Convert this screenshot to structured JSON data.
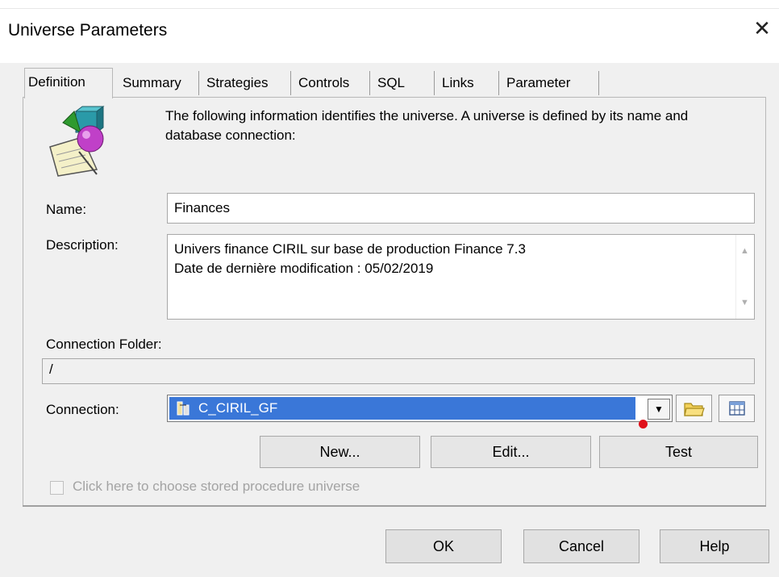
{
  "window": {
    "title": "Universe Parameters",
    "close_glyph": "✕"
  },
  "tabs": [
    {
      "label": "Definition",
      "active": true
    },
    {
      "label": "Summary",
      "active": false
    },
    {
      "label": "Strategies",
      "active": false
    },
    {
      "label": "Controls",
      "active": false
    },
    {
      "label": "SQL",
      "active": false
    },
    {
      "label": "Links",
      "active": false
    },
    {
      "label": "Parameter",
      "active": false
    }
  ],
  "definition": {
    "intro": "The following information identifies the universe. A universe is defined by its name and database connection:",
    "name_label": "Name:",
    "name_value": "Finances",
    "description_label": "Description:",
    "description_lines": [
      "Univers finance CIRIL sur base de production Finance 7.3",
      "Date de dernière modification : 05/02/2019"
    ],
    "connection_folder_label": "Connection Folder:",
    "connection_folder_value": "/",
    "connection_label": "Connection:",
    "connection_value": "C_CIRIL_GF",
    "buttons": {
      "new": "New...",
      "edit": "Edit...",
      "test": "Test"
    },
    "stored_procedure_label": "Click here to choose stored procedure universe",
    "stored_procedure_checked": false
  },
  "footer": {
    "ok": "OK",
    "cancel": "Cancel",
    "help": "Help"
  },
  "icons": {
    "universe": "universe-shapes-icon",
    "connection": "connection-icon",
    "folder": "folder-icon",
    "table": "table-icon"
  },
  "colors": {
    "selection": "#3a77d8",
    "dialog_bg": "#f0f0f0",
    "indicator": "#e0101a"
  }
}
